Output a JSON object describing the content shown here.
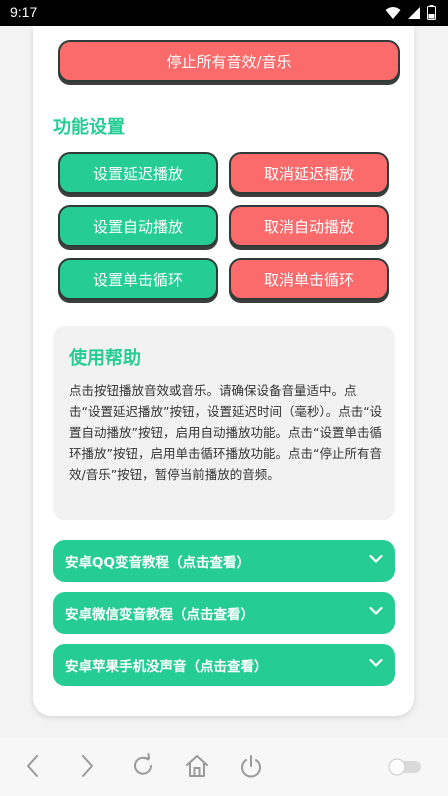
{
  "status": {
    "time": "9:17"
  },
  "top_button": {
    "label": "停止所有音效/音乐"
  },
  "section": {
    "title": "功能设置"
  },
  "buttons": [
    {
      "label": "设置延迟播放"
    },
    {
      "label": "取消延迟播放"
    },
    {
      "label": "设置自动播放"
    },
    {
      "label": "取消自动播放"
    },
    {
      "label": "设置单击循环"
    },
    {
      "label": "取消单击循环"
    }
  ],
  "help": {
    "title": "使用帮助",
    "text": "点击按钮播放音效或音乐。请确保设备音量适中。点击“设置延迟播放”按钮，设置延迟时间（毫秒）。点击“设置自动播放”按钮，启用自动播放功能。点击“设置单击循环播放”按钮，启用单击循环播放功能。点击“停止所有音效/音乐”按钮，暂停当前播放的音频。"
  },
  "accordions": [
    {
      "label": "安卓QQ变音教程（点击查看）"
    },
    {
      "label": "安卓微信变音教程（点击查看）"
    },
    {
      "label": "安卓苹果手机没声音（点击查看）"
    }
  ],
  "colors": {
    "accent": "#25cd94",
    "danger": "#fb6b6b",
    "card": "#ffffff"
  }
}
